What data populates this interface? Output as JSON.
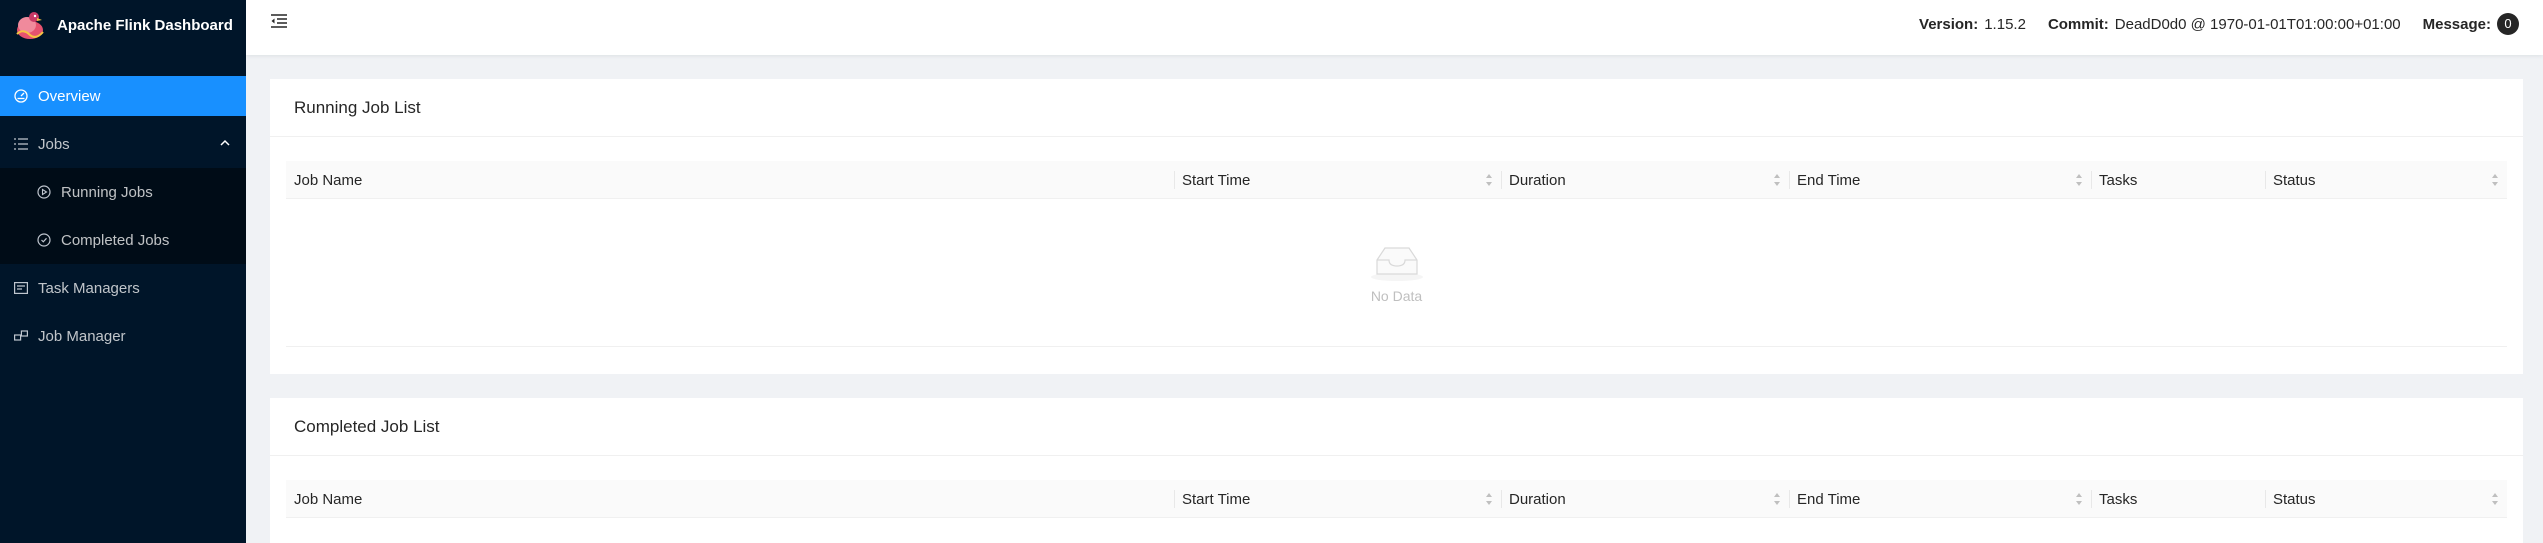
{
  "brand": {
    "title": "Apache Flink Dashboard"
  },
  "sidebar": {
    "items": [
      {
        "label": "Overview",
        "icon": "dashboard-icon"
      },
      {
        "label": "Jobs",
        "icon": "unordered-list-icon"
      },
      {
        "label": "Running Jobs",
        "icon": "play-circle-icon"
      },
      {
        "label": "Completed Jobs",
        "icon": "check-circle-icon"
      },
      {
        "label": "Task Managers",
        "icon": "schedule-icon"
      },
      {
        "label": "Job Manager",
        "icon": "build-icon"
      }
    ]
  },
  "header": {
    "version_label": "Version:",
    "version_value": "1.15.2",
    "commit_label": "Commit:",
    "commit_value": "DeadD0d0 @ 1970-01-01T01:00:00+01:00",
    "message_label": "Message:",
    "message_count": "0"
  },
  "running": {
    "title": "Running Job List",
    "columns": [
      "Job Name",
      "Start Time",
      "Duration",
      "End Time",
      "Tasks",
      "Status"
    ],
    "empty_text": "No Data"
  },
  "completed": {
    "title": "Completed Job List",
    "columns": [
      "Job Name",
      "Start Time",
      "Duration",
      "End Time",
      "Tasks",
      "Status"
    ]
  },
  "colors": {
    "sidebar": "#001529",
    "submenu": "#000c17",
    "active": "#1890ff"
  }
}
